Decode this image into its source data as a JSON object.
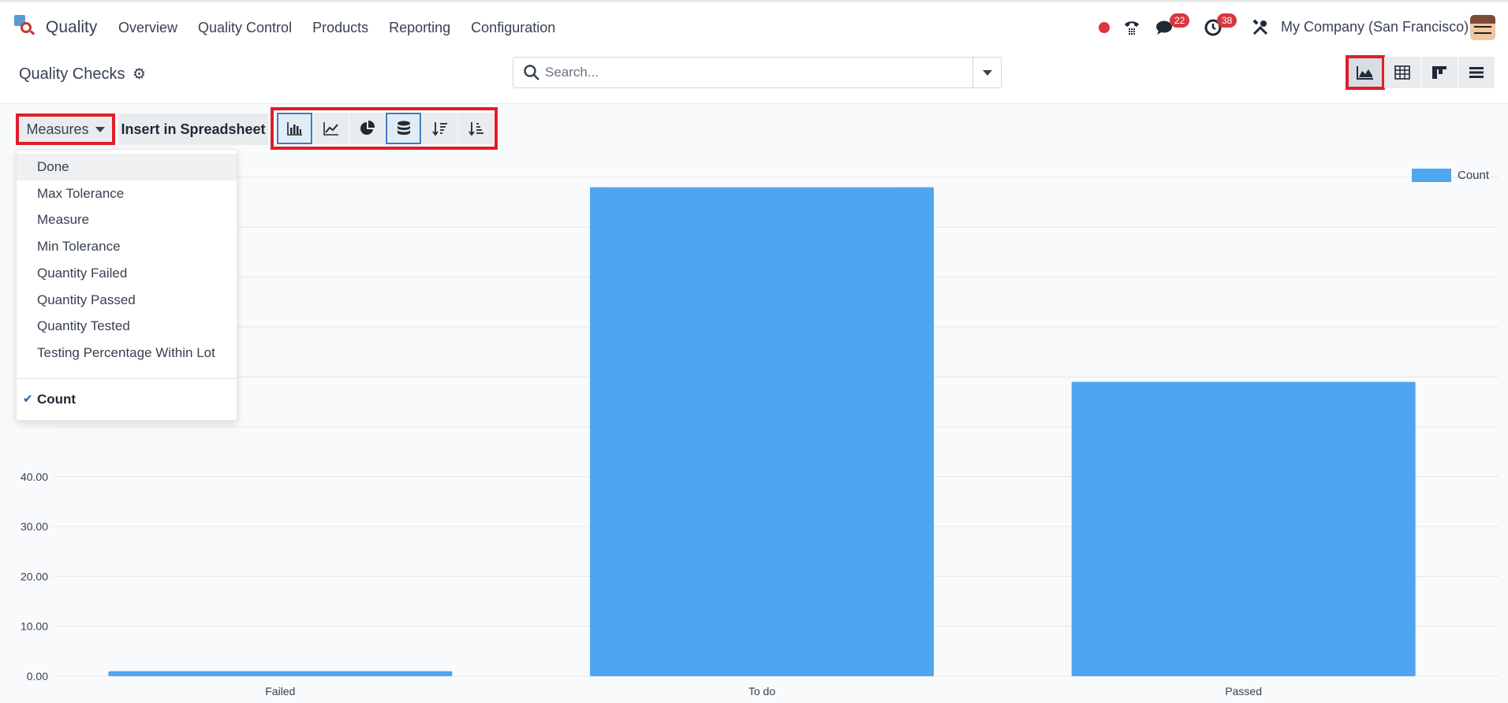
{
  "app": {
    "name": "Quality",
    "logo_icon": "quality-app-icon"
  },
  "nav": {
    "items": [
      {
        "label": "Overview"
      },
      {
        "label": "Quality Control"
      },
      {
        "label": "Products"
      },
      {
        "label": "Reporting"
      },
      {
        "label": "Configuration"
      }
    ]
  },
  "systray": {
    "messages_count": "22",
    "activities_count": "38",
    "company": "My Company (San Francisco)"
  },
  "control_panel": {
    "title": "Quality Checks",
    "search_placeholder": "Search..."
  },
  "toolbar": {
    "measures_label": "Measures",
    "insert_label": "Insert in Spreadsheet"
  },
  "measures_menu": {
    "items": [
      {
        "label": "Done"
      },
      {
        "label": "Max Tolerance"
      },
      {
        "label": "Measure"
      },
      {
        "label": "Min Tolerance"
      },
      {
        "label": "Quantity Failed"
      },
      {
        "label": "Quantity Passed"
      },
      {
        "label": "Quantity Tested"
      },
      {
        "label": "Testing Percentage Within Lot"
      }
    ],
    "count_label": "Count"
  },
  "colors": {
    "bar": "#4fa6f0",
    "highlight": "#e11d2a"
  },
  "chart_data": {
    "type": "bar",
    "categories": [
      "Failed",
      "To do",
      "Passed"
    ],
    "series": [
      {
        "name": "Count",
        "values": [
          1,
          98,
          59
        ]
      }
    ],
    "y_ticks": [
      "0.00",
      "10.00",
      "20.00",
      "30.00",
      "40.00"
    ],
    "ylim": [
      0,
      100
    ],
    "grid": true,
    "legend": "top-right"
  }
}
